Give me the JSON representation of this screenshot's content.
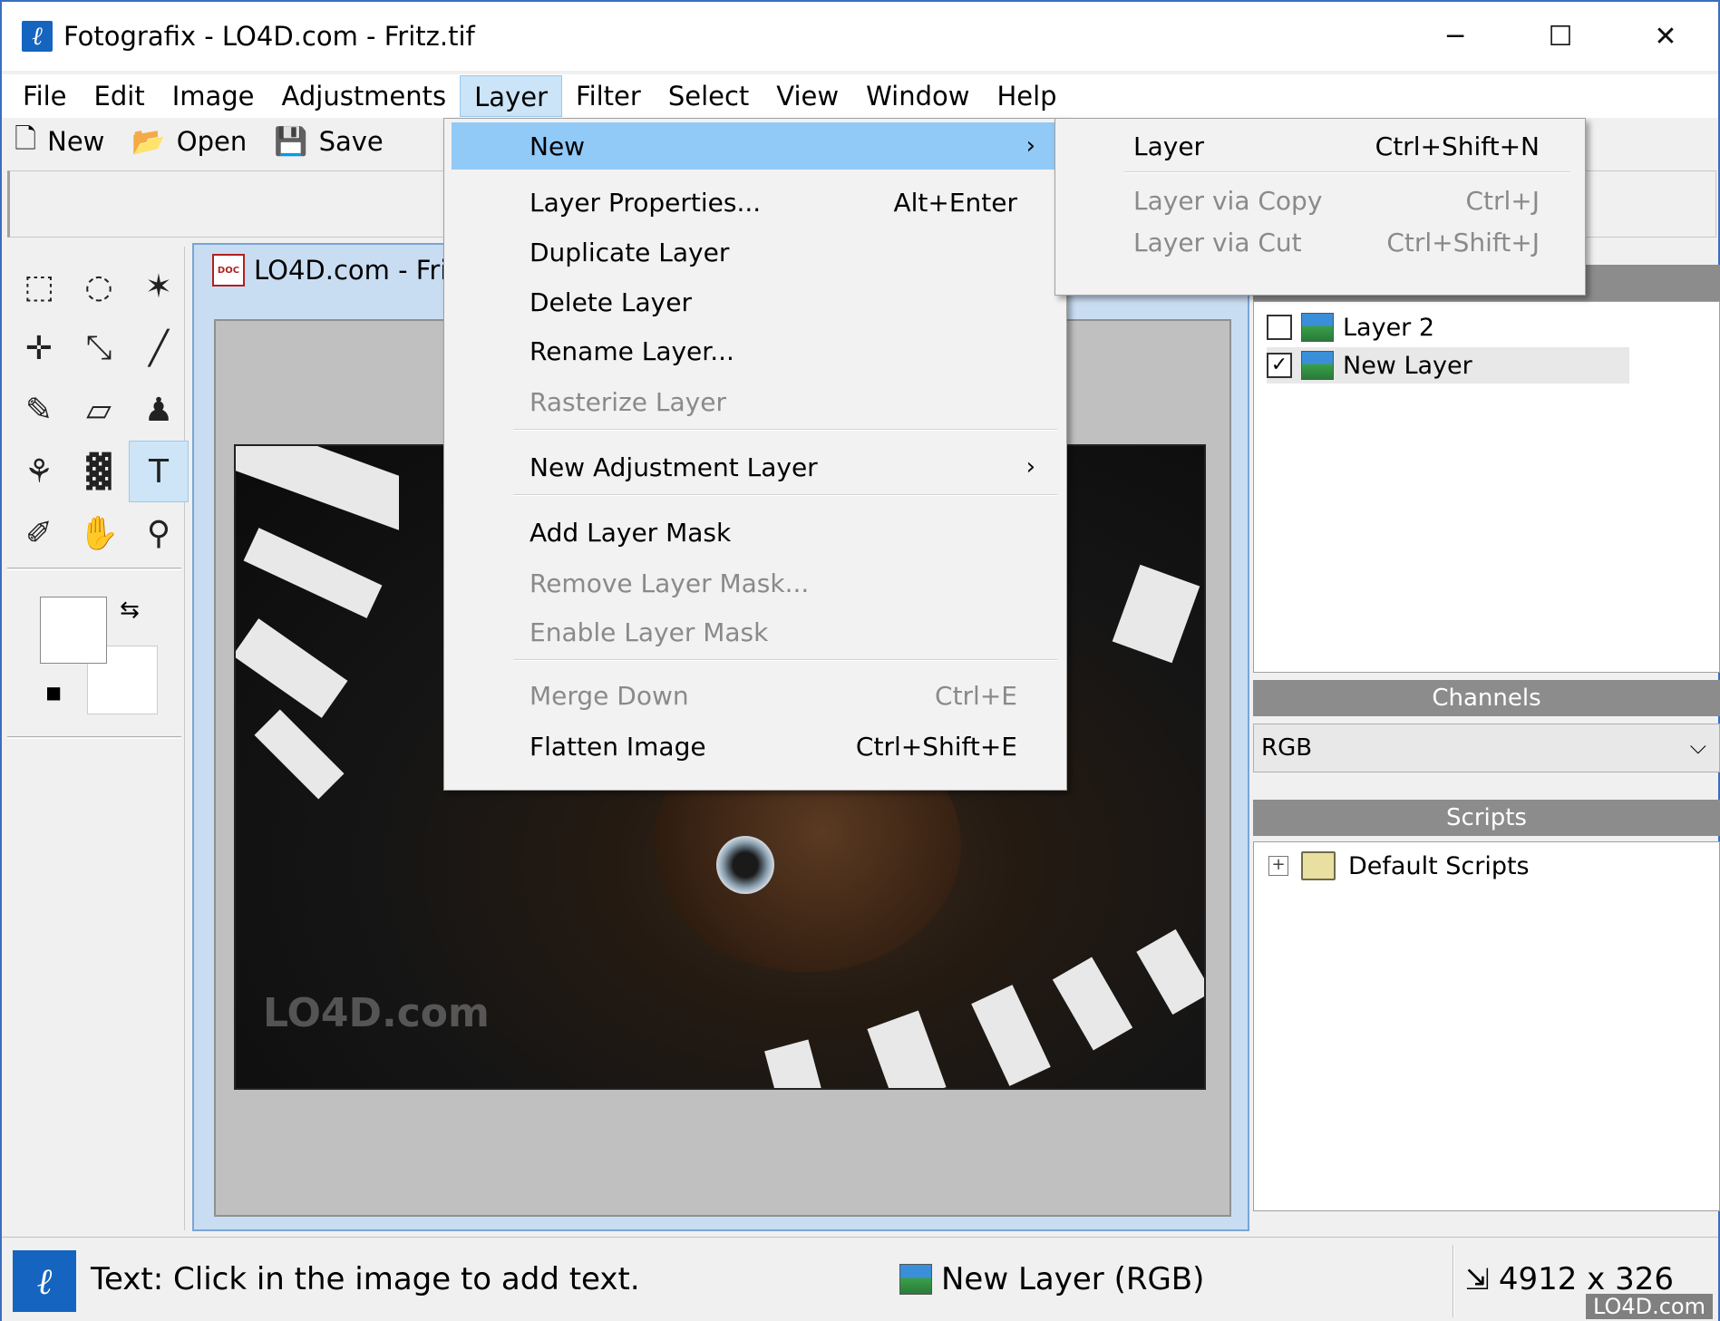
{
  "window": {
    "title": "Fotografix - LO4D.com - Fritz.tif",
    "minimize_glyph": "─",
    "maximize_glyph": "☐",
    "close_glyph": "✕"
  },
  "menubar": [
    "File",
    "Edit",
    "Image",
    "Adjustments",
    "Layer",
    "Filter",
    "Select",
    "View",
    "Window",
    "Help"
  ],
  "toolbar": {
    "new_label": "New",
    "open_label": "Open",
    "save_label": "Save"
  },
  "tools": [
    {
      "name": "rect-select-icon",
      "glyph": "⬚"
    },
    {
      "name": "ellipse-select-icon",
      "glyph": "◌"
    },
    {
      "name": "magic-wand-icon",
      "glyph": "✶"
    },
    {
      "name": "move-tool-icon",
      "glyph": "✛"
    },
    {
      "name": "crop-tool-icon",
      "glyph": "⤡"
    },
    {
      "name": "ruler-icon",
      "glyph": "╱"
    },
    {
      "name": "brush-icon",
      "glyph": "✎"
    },
    {
      "name": "eraser-icon",
      "glyph": "▱"
    },
    {
      "name": "clone-stamp-icon",
      "glyph": "♟"
    },
    {
      "name": "paint-bucket-icon",
      "glyph": "⚘"
    },
    {
      "name": "gradient-icon",
      "glyph": "▓"
    },
    {
      "name": "text-tool-icon",
      "glyph": "T"
    },
    {
      "name": "eyedropper-icon",
      "glyph": "✐"
    },
    {
      "name": "hand-tool-icon",
      "glyph": "✋"
    },
    {
      "name": "zoom-tool-icon",
      "glyph": "⚲"
    }
  ],
  "document": {
    "title": "LO4D.com - Fri",
    "watermark": "LO4D.com"
  },
  "layer_menu": {
    "items": [
      {
        "label": "New",
        "shortcut": "",
        "submenu": true,
        "disabled": false,
        "highlight": true
      },
      {
        "label": "Layer Properties...",
        "shortcut": "Alt+Enter",
        "disabled": false
      },
      {
        "label": "Duplicate Layer",
        "shortcut": "",
        "disabled": false
      },
      {
        "label": "Delete Layer",
        "shortcut": "",
        "disabled": false
      },
      {
        "label": "Rename Layer...",
        "shortcut": "",
        "disabled": false
      },
      {
        "label": "Rasterize Layer",
        "shortcut": "",
        "disabled": true
      },
      {
        "label": "New Adjustment Layer",
        "shortcut": "",
        "submenu": true,
        "disabled": false
      },
      {
        "label": "Add Layer Mask",
        "shortcut": "",
        "disabled": false
      },
      {
        "label": "Remove Layer Mask...",
        "shortcut": "",
        "disabled": true
      },
      {
        "label": "Enable Layer Mask",
        "shortcut": "",
        "disabled": true
      },
      {
        "label": "Merge Down",
        "shortcut": "Ctrl+E",
        "disabled": true
      },
      {
        "label": "Flatten Image",
        "shortcut": "Ctrl+Shift+E",
        "disabled": false
      }
    ],
    "submenu_arrow": "›"
  },
  "new_submenu": [
    {
      "label": "Layer",
      "shortcut": "Ctrl+Shift+N",
      "disabled": false
    },
    {
      "label": "Layer via Copy",
      "shortcut": "Ctrl+J",
      "disabled": true
    },
    {
      "label": "Layer via Cut",
      "shortcut": "Ctrl+Shift+J",
      "disabled": true
    }
  ],
  "layers_panel": {
    "layers": [
      {
        "name": "Layer 2",
        "visible": false
      },
      {
        "name": "New Layer",
        "visible": true
      }
    ]
  },
  "channels_panel": {
    "header": "Channels",
    "selected": "RGB"
  },
  "scripts_panel": {
    "header": "Scripts",
    "folder": "Default Scripts"
  },
  "statusbar": {
    "message": "Text: Click in the image to add text.",
    "layer": "New Layer (RGB)",
    "size": "4912 x 326"
  },
  "corner_watermark": "LO4D.com",
  "colors": {
    "accent": "#1565c0",
    "menu_highlight": "#91c9f7",
    "disabled_text": "#8a8a8a"
  }
}
